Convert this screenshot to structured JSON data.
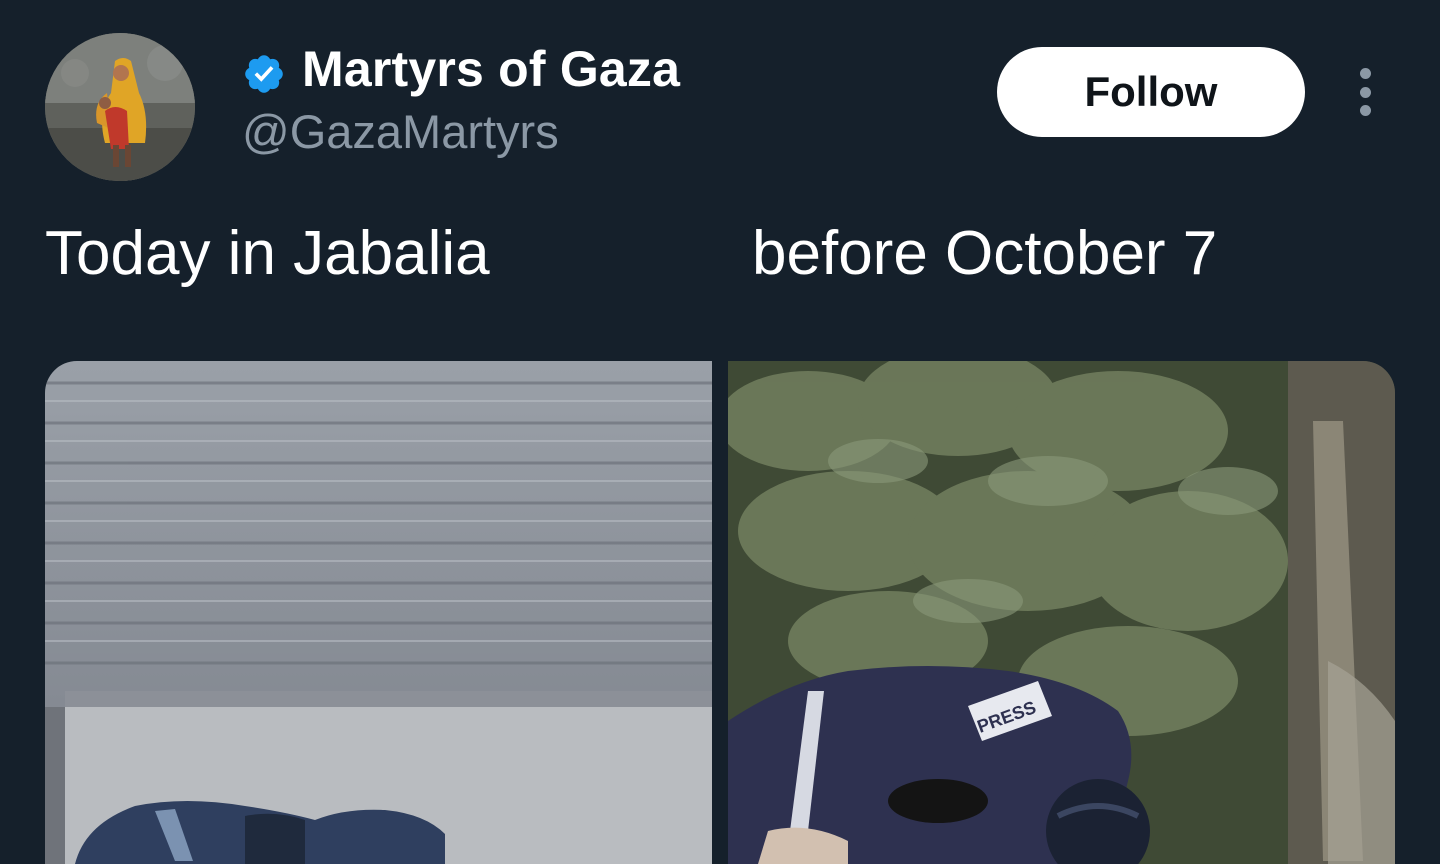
{
  "author": {
    "display_name": "Martyrs of Gaza",
    "handle": "@GazaMartyrs",
    "verified": true,
    "avatar_icon": "profile-photo-avatar",
    "verified_icon": "verified-badge-icon"
  },
  "actions": {
    "follow_label": "Follow",
    "more_icon": "more-vertical-icon"
  },
  "tweet": {
    "text_left": "Today in Jabalia",
    "text_right": "before October 7"
  },
  "media": {
    "left_alt": "photo-jabalia",
    "right_alt": "photo-before-october-7"
  },
  "colors": {
    "background": "#15202b",
    "name": "#ffffff",
    "handle": "#8b98a5",
    "verified": "#1d9bf0",
    "follow_bg": "#ffffff",
    "follow_text": "#0f1419"
  }
}
